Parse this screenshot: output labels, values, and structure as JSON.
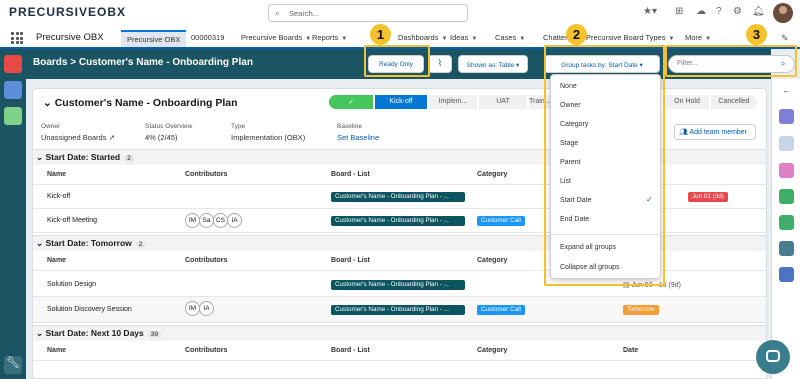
{
  "header": {
    "logo_text": "PRECURSIVEOBX",
    "search_placeholder": "Search...",
    "icons": [
      "star-icon",
      "add-icon",
      "cloud-icon",
      "help-icon",
      "gear-icon",
      "bell-icon"
    ]
  },
  "nav": {
    "app_name": "Precursive OBX",
    "tabs": [
      {
        "label": "Precursive OBX",
        "active": true
      },
      {
        "label": "00000319"
      },
      {
        "label": "Precursive Boards"
      },
      {
        "label": "Reports"
      },
      {
        "label": "Dashboards"
      },
      {
        "label": "Ideas"
      },
      {
        "label": "Cases"
      },
      {
        "label": "Chatter"
      },
      {
        "label": "Precursive Board Types"
      },
      {
        "label": "More"
      }
    ]
  },
  "board": {
    "title": "Boards > Customer's Name - Onboarding Plan",
    "ready_only": "Ready Only",
    "shown_as": "Shown as: Table",
    "group_by_label": "Group tasks by: Start Date",
    "filter_placeholder": "Filter..."
  },
  "plan": {
    "title": "Customer's Name - Onboarding Plan",
    "stages": [
      "✓",
      "Kick-off",
      "Implem...",
      "UAT",
      "Traini...",
      "On Hold",
      "Cancelled"
    ],
    "active_stage": "Kick-off",
    "owner_label": "Owner",
    "owner_value": "Unassigned Boards",
    "status_label": "Status Overview",
    "status_value": "4% (2/45)",
    "type_label": "Type",
    "type_value": "Implementation (OBX)",
    "baseline_label": "Baseline",
    "baseline_link": "Set Baseline",
    "add_team": "Add team member"
  },
  "columns": {
    "name": "Name",
    "contributors": "Contributors",
    "board_list": "Board - List",
    "category": "Category",
    "date": "Date"
  },
  "groups": [
    {
      "label": "Start Date: Started",
      "count": "2",
      "rows": [
        {
          "name": "Kick-off",
          "contributors": [],
          "board": "Customer's Name - Onboarding Plan - ...",
          "category": "",
          "date": "Jun 01 (3d)"
        },
        {
          "name": "Kick-off Meeting",
          "contributors": [
            "IM",
            "Sa",
            "CS",
            "IA"
          ],
          "board": "Customer's Name - Onboarding Plan - ...",
          "category": "Customer Call",
          "date": ""
        }
      ]
    },
    {
      "label": "Start Date: Tomorrow",
      "count": "2",
      "rows": [
        {
          "name": "Solution Design",
          "contributors": [],
          "board": "Customer's Name - Onboarding Plan - ...",
          "category": "",
          "date": "Jun 03 - 15 (9d)"
        },
        {
          "name": "Solution Discovery Session",
          "contributors": [
            "IM",
            "IA"
          ],
          "board": "Customer's Name - Onboarding Plan - ...",
          "category": "Customer Call",
          "date": "Tomorrow"
        }
      ]
    },
    {
      "label": "Start Date: Next 10 Days",
      "count": "39",
      "rows": []
    }
  ],
  "group_menu": {
    "items": [
      "None",
      "Owner",
      "Category",
      "Stage",
      "Parent",
      "List",
      "Start Date",
      "End Date"
    ],
    "selected": "Start Date",
    "actions": [
      "Expand all groups",
      "Collapse all groups"
    ]
  },
  "callouts": [
    "1",
    "2",
    "3"
  ],
  "colors": {
    "brand": "#1b5563",
    "accent": "#0176d3",
    "callout": "#f3c22d",
    "tag_orange": "#f59d3a",
    "tag_red": "#e8484a"
  }
}
